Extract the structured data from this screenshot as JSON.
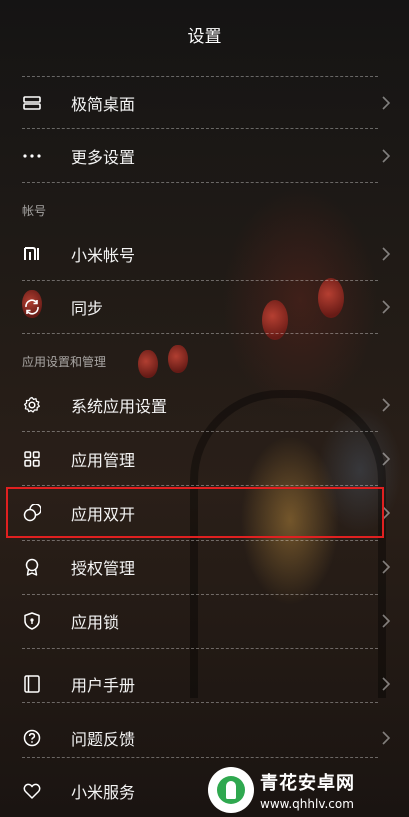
{
  "header": {
    "title": "设置"
  },
  "items_top": [
    {
      "label": "极简桌面",
      "icon": "minimal-desktop-icon"
    },
    {
      "label": "更多设置",
      "icon": "more-dots-icon"
    }
  ],
  "section_account": {
    "label": "帐号"
  },
  "items_account": [
    {
      "label": "小米帐号",
      "icon": "mi-logo-icon"
    },
    {
      "label": "同步",
      "icon": "sync-icon"
    }
  ],
  "section_apps": {
    "label": "应用设置和管理"
  },
  "items_apps": [
    {
      "label": "系统应用设置",
      "icon": "gear-icon"
    },
    {
      "label": "应用管理",
      "icon": "grid-icon"
    },
    {
      "label": "应用双开",
      "icon": "dual-app-icon"
    },
    {
      "label": "授权管理",
      "icon": "award-icon"
    },
    {
      "label": "应用锁",
      "icon": "shield-lock-icon"
    },
    {
      "label": "用户手册",
      "icon": "book-icon"
    },
    {
      "label": "问题反馈",
      "icon": "question-icon"
    },
    {
      "label": "小米服务",
      "icon": "heart-icon"
    }
  ],
  "watermark": {
    "name": "青花安卓网",
    "url": "www.qhhlv.com"
  },
  "colors": {
    "highlight": "#e02020",
    "text": "#f4f4f4"
  }
}
